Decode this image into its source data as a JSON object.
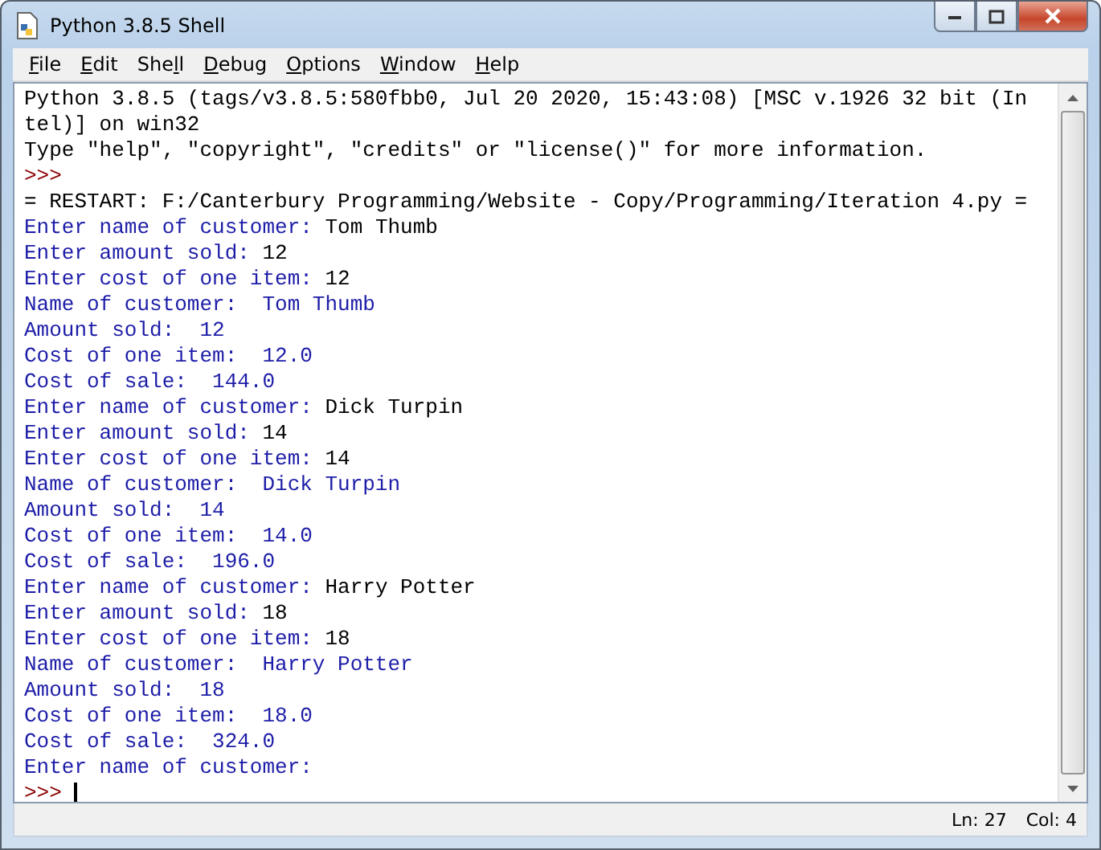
{
  "window": {
    "title": "Python 3.8.5 Shell"
  },
  "menu": [
    {
      "parts": [
        {
          "text": "F",
          "underlined": true
        },
        {
          "text": "ile",
          "underlined": false
        }
      ]
    },
    {
      "parts": [
        {
          "text": "E",
          "underlined": true
        },
        {
          "text": "dit",
          "underlined": false
        }
      ]
    },
    {
      "parts": [
        {
          "text": "She",
          "underlined": false
        },
        {
          "text": "l",
          "underlined": true
        },
        {
          "text": "l",
          "underlined": false
        }
      ]
    },
    {
      "parts": [
        {
          "text": "D",
          "underlined": true
        },
        {
          "text": "ebug",
          "underlined": false
        }
      ]
    },
    {
      "parts": [
        {
          "text": "O",
          "underlined": true
        },
        {
          "text": "ptions",
          "underlined": false
        }
      ]
    },
    {
      "parts": [
        {
          "text": "W",
          "underlined": true
        },
        {
          "text": "indow",
          "underlined": false
        }
      ]
    },
    {
      "parts": [
        {
          "text": "H",
          "underlined": true
        },
        {
          "text": "elp",
          "underlined": false
        }
      ]
    }
  ],
  "console": {
    "lines": [
      {
        "segments": [
          {
            "kind": "output",
            "text": "Python 3.8.5 (tags/v3.8.5:580fbb0, Jul 20 2020, 15:43:08) [MSC v.1926 32 bit (In"
          }
        ]
      },
      {
        "segments": [
          {
            "kind": "output",
            "text": "tel)] on win32"
          }
        ]
      },
      {
        "segments": [
          {
            "kind": "output",
            "text": "Type \"help\", \"copyright\", \"credits\" or \"license()\" for more information."
          }
        ]
      },
      {
        "segments": [
          {
            "kind": "prompt",
            "text": ">>>"
          }
        ]
      },
      {
        "segments": [
          {
            "kind": "output",
            "text": "= RESTART: F:/Canterbury Programming/Website - Copy/Programming/Iteration 4.py ="
          }
        ]
      },
      {
        "segments": [
          {
            "kind": "stdout",
            "text": "Enter name of customer: "
          },
          {
            "kind": "input",
            "text": "Tom Thumb"
          }
        ]
      },
      {
        "segments": [
          {
            "kind": "stdout",
            "text": "Enter amount sold: "
          },
          {
            "kind": "input",
            "text": "12"
          }
        ]
      },
      {
        "segments": [
          {
            "kind": "stdout",
            "text": "Enter cost of one item: "
          },
          {
            "kind": "input",
            "text": "12"
          }
        ]
      },
      {
        "segments": [
          {
            "kind": "stdout",
            "text": "Name of customer:  Tom Thumb"
          }
        ]
      },
      {
        "segments": [
          {
            "kind": "stdout",
            "text": "Amount sold:  12"
          }
        ]
      },
      {
        "segments": [
          {
            "kind": "stdout",
            "text": "Cost of one item:  12.0"
          }
        ]
      },
      {
        "segments": [
          {
            "kind": "stdout",
            "text": "Cost of sale:  144.0"
          }
        ]
      },
      {
        "segments": [
          {
            "kind": "stdout",
            "text": "Enter name of customer: "
          },
          {
            "kind": "input",
            "text": "Dick Turpin"
          }
        ]
      },
      {
        "segments": [
          {
            "kind": "stdout",
            "text": "Enter amount sold: "
          },
          {
            "kind": "input",
            "text": "14"
          }
        ]
      },
      {
        "segments": [
          {
            "kind": "stdout",
            "text": "Enter cost of one item: "
          },
          {
            "kind": "input",
            "text": "14"
          }
        ]
      },
      {
        "segments": [
          {
            "kind": "stdout",
            "text": "Name of customer:  Dick Turpin"
          }
        ]
      },
      {
        "segments": [
          {
            "kind": "stdout",
            "text": "Amount sold:  14"
          }
        ]
      },
      {
        "segments": [
          {
            "kind": "stdout",
            "text": "Cost of one item:  14.0"
          }
        ]
      },
      {
        "segments": [
          {
            "kind": "stdout",
            "text": "Cost of sale:  196.0"
          }
        ]
      },
      {
        "segments": [
          {
            "kind": "stdout",
            "text": "Enter name of customer: "
          },
          {
            "kind": "input",
            "text": "Harry Potter"
          }
        ]
      },
      {
        "segments": [
          {
            "kind": "stdout",
            "text": "Enter amount sold: "
          },
          {
            "kind": "input",
            "text": "18"
          }
        ]
      },
      {
        "segments": [
          {
            "kind": "stdout",
            "text": "Enter cost of one item: "
          },
          {
            "kind": "input",
            "text": "18"
          }
        ]
      },
      {
        "segments": [
          {
            "kind": "stdout",
            "text": "Name of customer:  Harry Potter"
          }
        ]
      },
      {
        "segments": [
          {
            "kind": "stdout",
            "text": "Amount sold:  18"
          }
        ]
      },
      {
        "segments": [
          {
            "kind": "stdout",
            "text": "Cost of one item:  18.0"
          }
        ]
      },
      {
        "segments": [
          {
            "kind": "stdout",
            "text": "Cost of sale:  324.0"
          }
        ]
      },
      {
        "segments": [
          {
            "kind": "stdout",
            "text": "Enter name of customer: "
          }
        ]
      },
      {
        "segments": [
          {
            "kind": "prompt",
            "text": ">>> "
          }
        ],
        "cursor": true
      }
    ]
  },
  "status_bar": {
    "line": "Ln: 27",
    "column": "Col: 4"
  }
}
